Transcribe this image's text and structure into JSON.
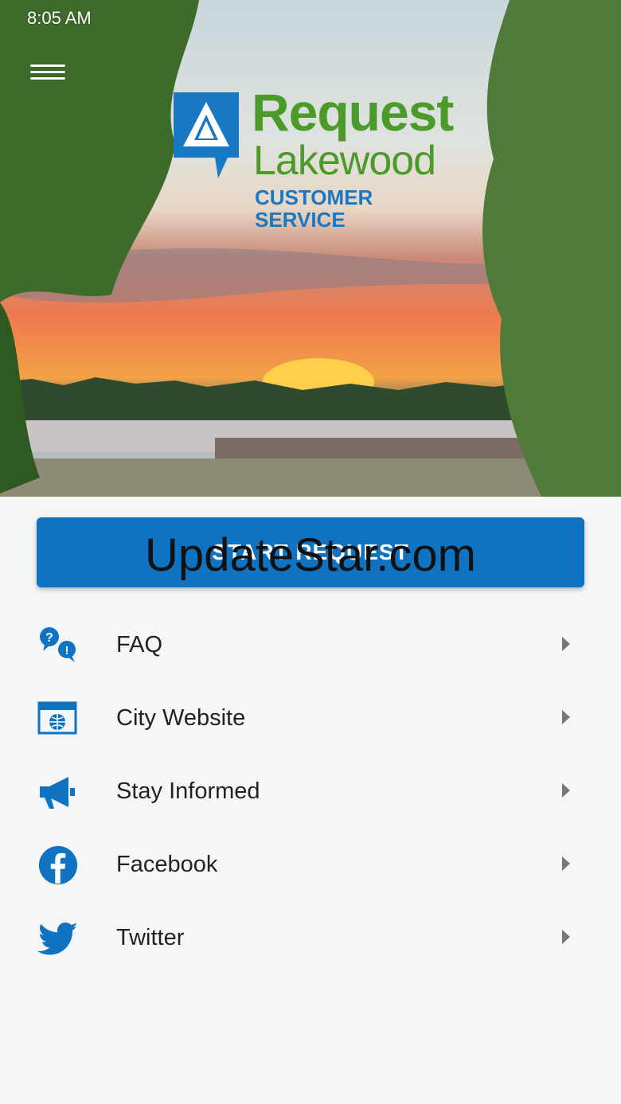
{
  "status_bar": {
    "time": "8:05 AM"
  },
  "logo": {
    "line1": "Request",
    "line2": "Lakewood",
    "line3": "CUSTOMER SERVICE"
  },
  "primary_action": {
    "label": "START REQUEST"
  },
  "watermark": "UpdateStar.com",
  "menu": [
    {
      "label": "FAQ",
      "icon": "faq-icon"
    },
    {
      "label": "City Website",
      "icon": "globe-icon"
    },
    {
      "label": "Stay Informed",
      "icon": "megaphone-icon"
    },
    {
      "label": "Facebook",
      "icon": "facebook-icon"
    },
    {
      "label": "Twitter",
      "icon": "twitter-icon"
    }
  ],
  "colors": {
    "brand_blue": "#0f73c2",
    "brand_green": "#4c9a2a",
    "background": "#f4f6f8"
  }
}
